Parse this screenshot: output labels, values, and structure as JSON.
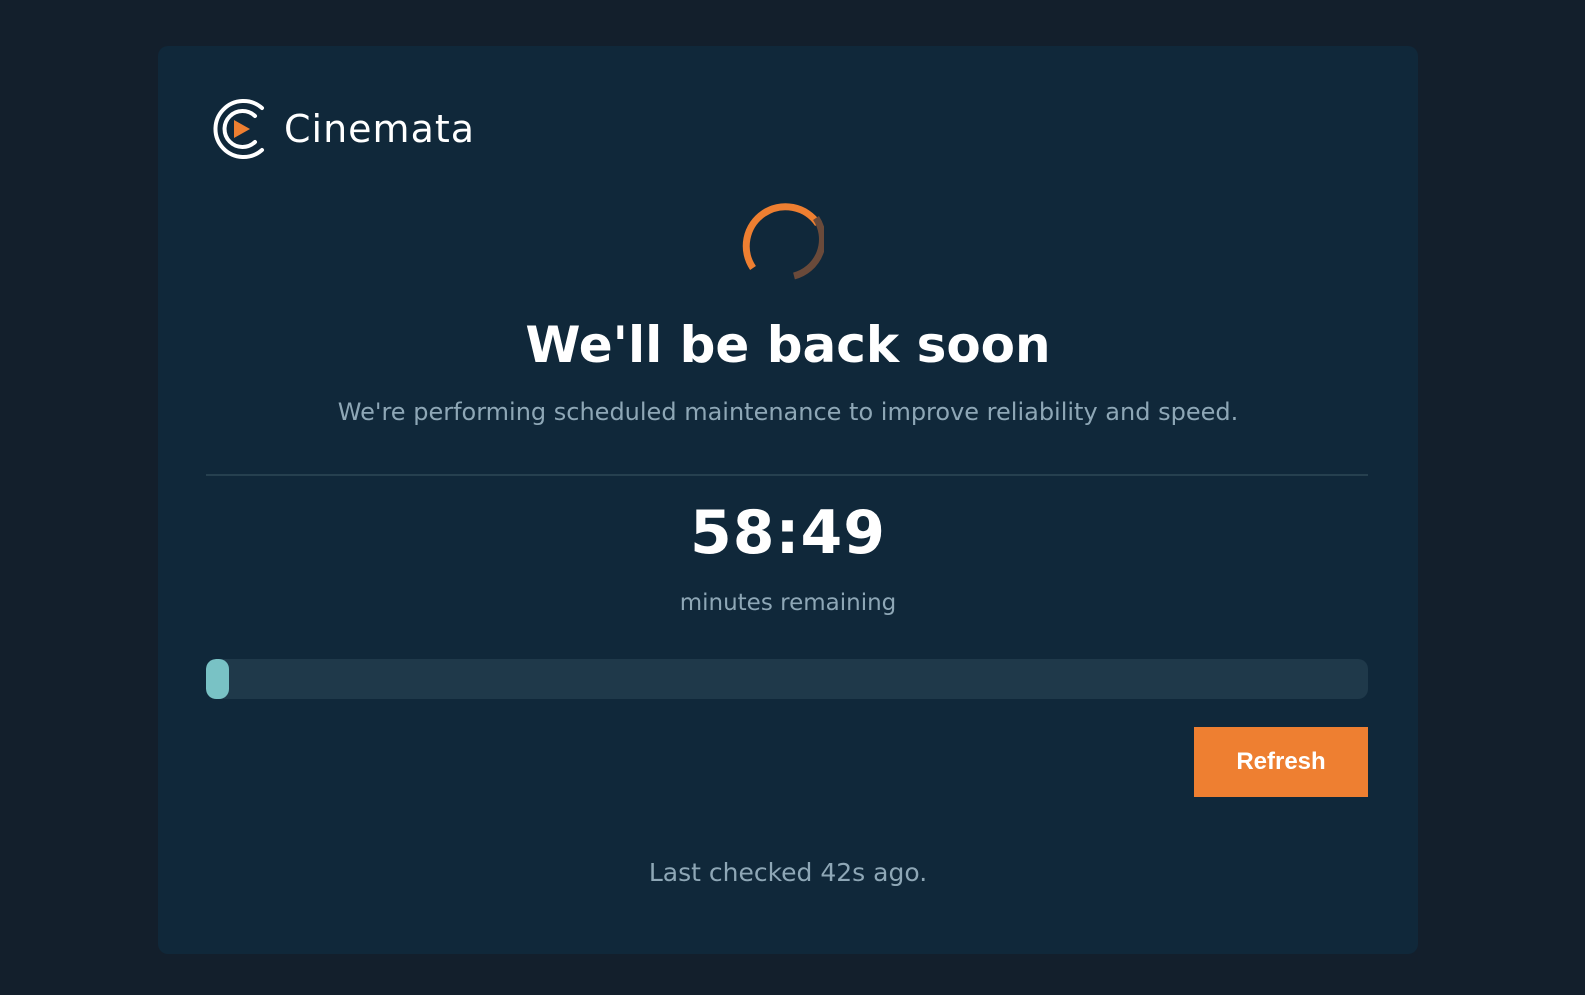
{
  "brand": {
    "name": "Cinemata",
    "logo_icon": "play-in-circle-logo-icon"
  },
  "status": {
    "spinner_icon": "loading-spinner-icon",
    "title": "We'll be back soon",
    "message": "We're performing scheduled maintenance to improve reliability and speed."
  },
  "countdown": {
    "time": "58:49",
    "label": "minutes remaining",
    "progress_fraction": 0.02
  },
  "actions": {
    "refresh_label": "Refresh"
  },
  "footer": {
    "last_checked": "Last checked 42s ago."
  },
  "colors": {
    "page_background": "#131f2c",
    "card_background": "#10283a",
    "accent_orange": "#ee7f31",
    "progress_fill": "#79c2c5",
    "progress_track": "#1f394a",
    "muted_text": "#8ea7b6"
  }
}
